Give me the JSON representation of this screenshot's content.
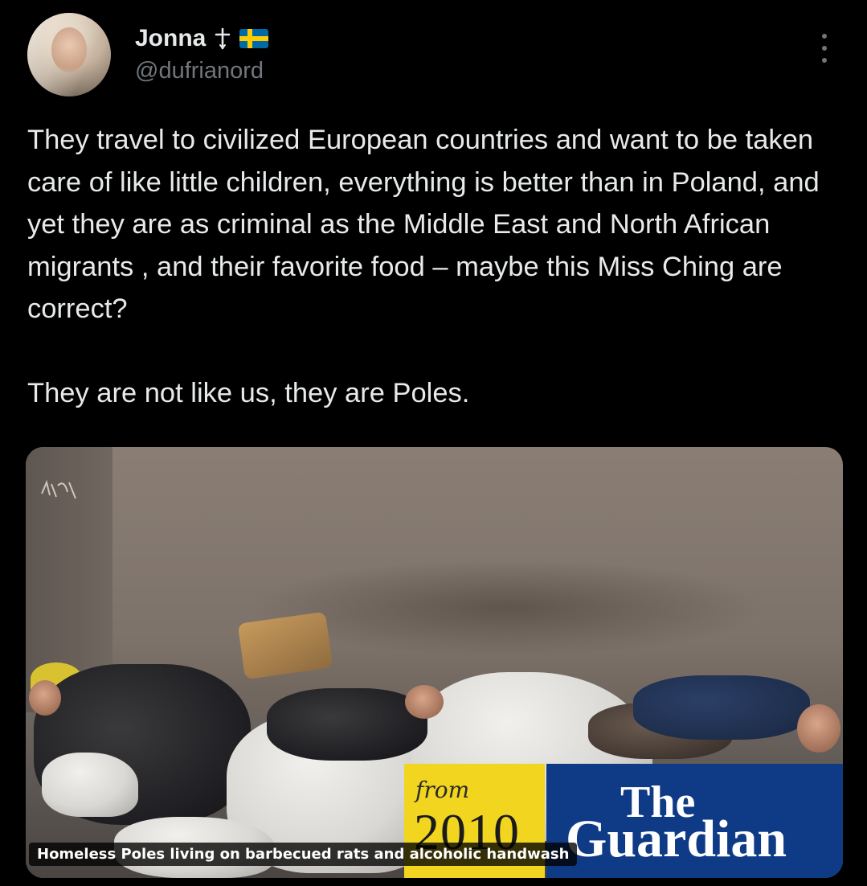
{
  "author": {
    "display_name": "Jonna",
    "handle": "@dufrianord",
    "avatar_icon": "profile-photo",
    "name_decorations": [
      "cross-icon",
      "sweden-flag-icon"
    ]
  },
  "tweet": {
    "paragraphs": [
      "They travel to civilized European countries and want to be taken care of like little children, everything is better than in Poland, and yet they are as criminal as the Middle East and North African migrants , and their favorite food – maybe this Miss Ching are correct?",
      "They are not like us, they are Poles."
    ]
  },
  "media": {
    "caption": "Homeless Poles living on barbecued rats and alcoholic handwash",
    "stamp": {
      "from_label": "from",
      "year": "2010",
      "brand_line1": "The",
      "brand_line2": "Guardian"
    }
  },
  "colors": {
    "background": "#000000",
    "primary_text": "#e7e9ea",
    "secondary_text": "#71767b",
    "stamp_yellow": "#f1d51f",
    "stamp_blue": "#0f3b86"
  }
}
